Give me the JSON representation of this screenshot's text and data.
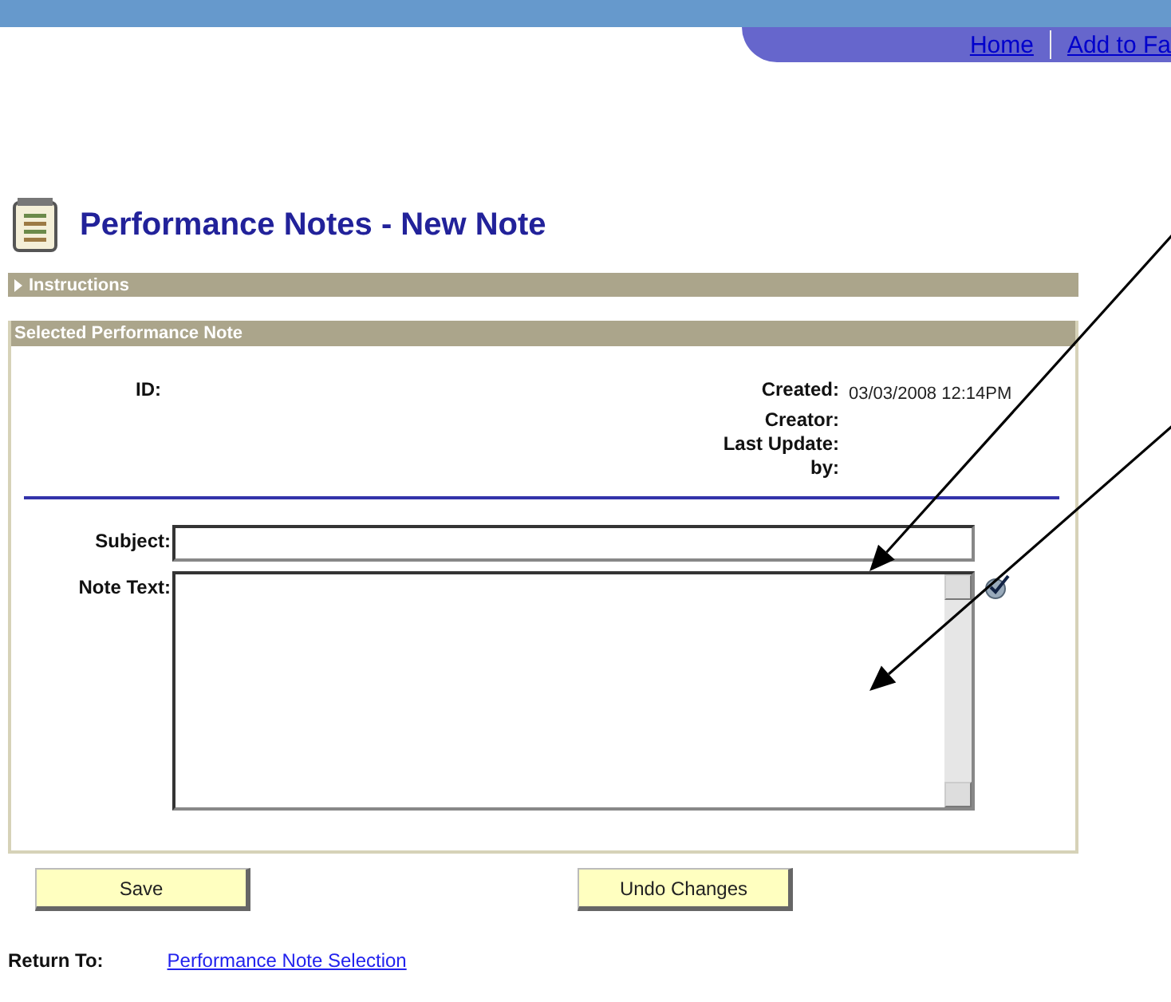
{
  "header": {
    "links": [
      "Home",
      "Add to Fa"
    ]
  },
  "page": {
    "title": "Performance Notes - New Note"
  },
  "instructions": {
    "label": "Instructions",
    "expanded": false
  },
  "section": {
    "title": "Selected Performance Note",
    "id_label": "ID:",
    "info": [
      {
        "label": "Created:",
        "value": "03/03/2008 12:14PM"
      },
      {
        "label": "Creator:"
      },
      {
        "label": "Last Update:"
      },
      {
        "label": "by:"
      }
    ],
    "subject_label": "Subject:",
    "note_label": "Note Text:"
  },
  "buttons": [
    "Save",
    "Undo Changes"
  ],
  "return_to": {
    "label": "Return To:",
    "link": "Performance Note Selection"
  }
}
